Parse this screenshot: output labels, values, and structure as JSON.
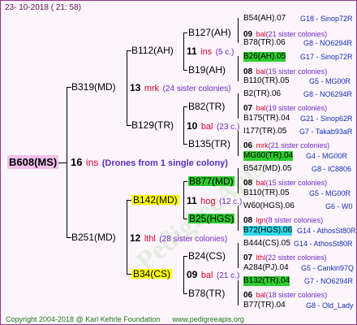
{
  "date": "23- 10-2018 ( 21: 58)",
  "footer": {
    "copyright": "Copyright 2004-2018 @ Karl Kehrle Foundation",
    "url": "www.pedigreeapis.org"
  },
  "watermark": "PedigreeApis",
  "root": {
    "name": "B608(MS)",
    "num": "16",
    "ins": "ins",
    "comment": "(Drones from 1 single colony)"
  },
  "g1": [
    {
      "name": "B319(MD)",
      "num": "13",
      "ins": "mrk",
      "comment": "(24 sister colonies)"
    },
    {
      "name": "B251(MD)",
      "num": "12",
      "ins": "lthl",
      "comment": "(28 sister colonies)"
    }
  ],
  "g2": [
    {
      "name": "B112(AH)",
      "num": "11",
      "ins": "ins",
      "comment": "(5 c.)"
    },
    {
      "name": "B129(TR)",
      "num": "10",
      "ins": "bal",
      "comment": "(23 c.)"
    },
    {
      "name": "B142(MD)",
      "num": "11",
      "ins": "hog",
      "comment": "(12 c.)"
    },
    {
      "name": "B34(CS)",
      "num": "09",
      "ins": "bal",
      "comment": "(21 c.)"
    }
  ],
  "g3": [
    {
      "name": "B127(AH)",
      "num": "09",
      "ins": "bal",
      "comment": "(21 sister colonies)"
    },
    {
      "name": "B19(AH)",
      "num": "08",
      "ins": "bal",
      "comment": "(15 sister colonies)"
    },
    {
      "name": "B82(TR)",
      "num": "07",
      "ins": "bal",
      "comment": "(19 sister colonies)"
    },
    {
      "name": "B135(TR)",
      "num": "06",
      "ins": "mrk",
      "comment": "(21 sister colonies)"
    },
    {
      "name": "B877(MD)",
      "num": "08",
      "ins": "bal",
      "comment": "(15 sister colonies)"
    },
    {
      "name": "B25(HGS)",
      "num": "08",
      "ins": "lgn",
      "comment": "(8 sister colonies)"
    },
    {
      "name": "B24(CS)",
      "num": "07",
      "ins": "lthl",
      "comment": "(22 sister colonies)"
    },
    {
      "name": "B78(TR)",
      "num": "06",
      "ins": "bal",
      "comment": "(18 sister colonies)"
    }
  ],
  "g4": [
    {
      "name": "B54(AH).07",
      "code": "G18 - Sinop72R"
    },
    {
      "name": "B78(TR).06",
      "code": "G8 - NO6294R"
    },
    {
      "name": "B26(AH).05",
      "code": "G17 - Sinop72R"
    },
    {
      "name": "B110(TR).05",
      "code": "G5 - MG00R"
    },
    {
      "name": "B2(TR).06",
      "code": "G8 - NO6294R"
    },
    {
      "name": "B175(TR).04",
      "code": "G21 - Sinop62R"
    },
    {
      "name": "I177(TR).05",
      "code": "G7 - Takab93aR"
    },
    {
      "name": "MG60(TR).04",
      "code": "G4 - MG00R"
    },
    {
      "name": "B547(MD).05",
      "code": "G8 - IC8806"
    },
    {
      "name": "B110(TR).05",
      "code": "G5 - MG00R"
    },
    {
      "name": "W60(HGS).06",
      "code": "G6 - W0"
    },
    {
      "name": "B72(HGS).06",
      "code": "G14 - AthosSt80R"
    },
    {
      "name": "B444(CS).05",
      "code": "G14 - AthosSt80R"
    },
    {
      "name": "A284(PJ).04",
      "code": "G5 - Cankiri97Q"
    },
    {
      "name": "B132(TR).04",
      "code": "G7 - NO6294R"
    },
    {
      "name": "B77(TR).04",
      "code": "G8 - Old_Lady"
    }
  ]
}
